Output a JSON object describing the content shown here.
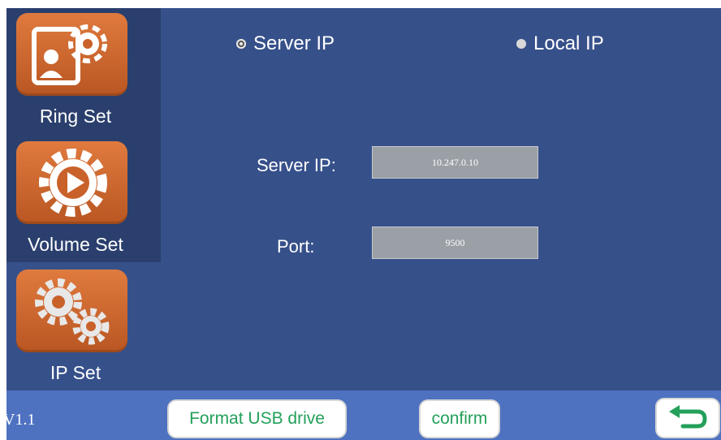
{
  "sidebar": {
    "items": [
      {
        "label": "Ring Set",
        "icon": "ring-settings-icon"
      },
      {
        "label": "Volume Set",
        "icon": "play-gear-icon"
      },
      {
        "label": "IP Set",
        "icon": "gears-icon"
      }
    ],
    "selected": "IP Set"
  },
  "mode": {
    "options": [
      {
        "label": "Server IP",
        "selected": true
      },
      {
        "label": "Local IP",
        "selected": false
      }
    ]
  },
  "form": {
    "server_ip_label": "Server IP:",
    "server_ip_value": "10.247.0.10",
    "port_label": "Port:",
    "port_value": "9500"
  },
  "footer": {
    "version": "V1.1",
    "format_label": "Format USB drive",
    "confirm_label": "confirm",
    "back_icon": "back-arrow-icon"
  },
  "colors": {
    "background": "#36508a",
    "sidebar": "#2a3f6d",
    "tile": "#d46a30",
    "footer": "#4e72c0",
    "button_text": "#23a05a"
  }
}
